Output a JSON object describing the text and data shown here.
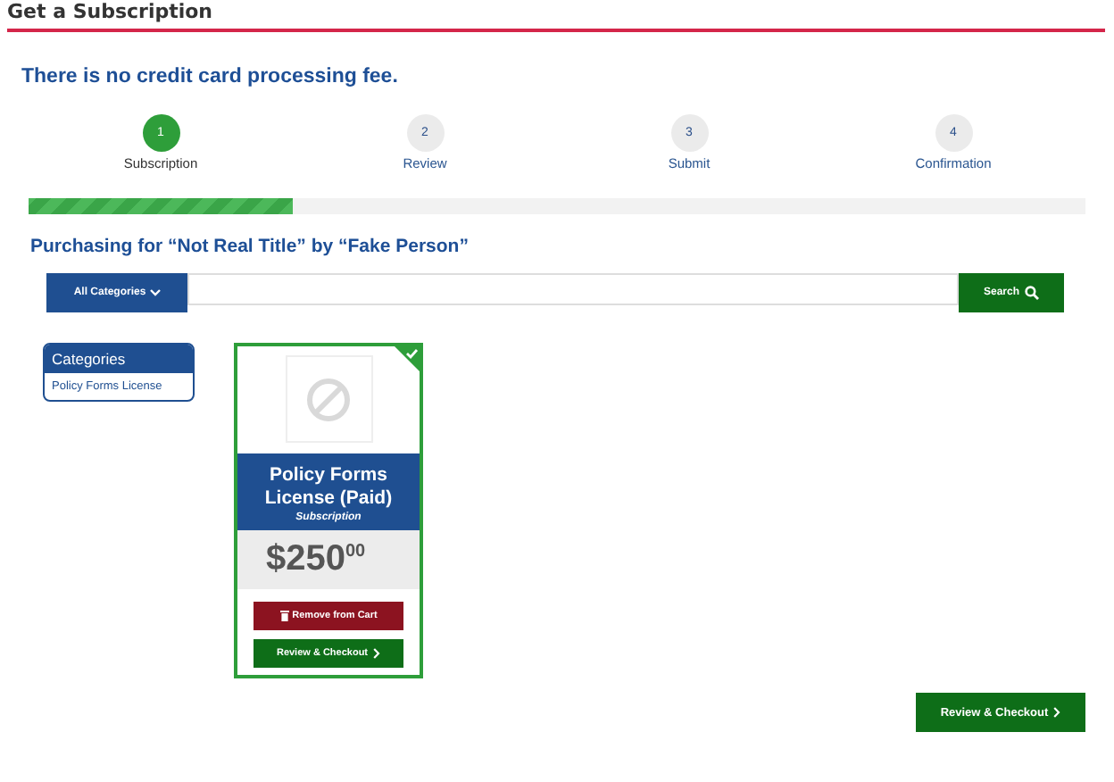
{
  "page_title": "Get a Subscription",
  "notice": "There is no credit card processing fee.",
  "steps": [
    {
      "number": "1",
      "label": "Subscription",
      "selected": true
    },
    {
      "number": "2",
      "label": "Review",
      "selected": false
    },
    {
      "number": "3",
      "label": "Submit",
      "selected": false
    },
    {
      "number": "4",
      "label": "Confirmation",
      "selected": false
    }
  ],
  "progress": {
    "level": 0.25
  },
  "purchasing_heading": "Purchasing for “Not Real Title” by “Fake Person”",
  "search": {
    "category_button": "All Categories",
    "search_button": "Search"
  },
  "categories": {
    "title": "Categories",
    "items": [
      {
        "label": "Policy Forms License"
      }
    ]
  },
  "products": [
    {
      "name": "Policy Forms License (Paid)",
      "type": "Subscription",
      "price": "$250$^{00}$",
      "in_cart": true,
      "remove_button": "Remove from Cart",
      "checkout_button": "Review & Checkout"
    }
  ],
  "checkout_button": "Review & Checkout"
}
